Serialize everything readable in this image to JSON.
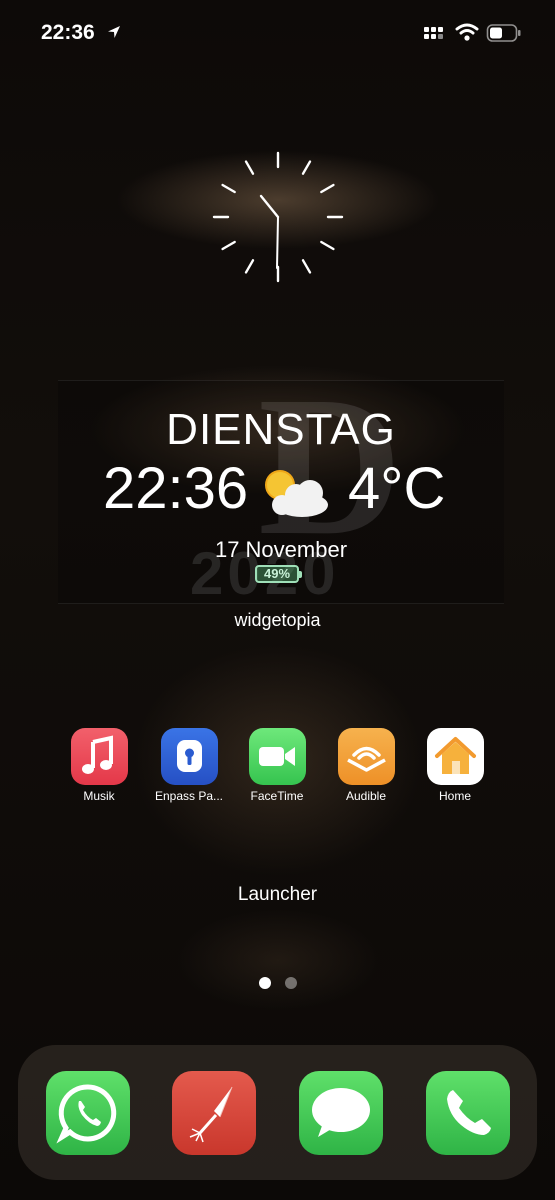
{
  "status_bar": {
    "time": "22:36"
  },
  "widget": {
    "day": "DIENSTAG",
    "time": "22:36",
    "temperature": "4°C",
    "date": "17 November",
    "battery": "49%",
    "bg_letter": "D",
    "bg_year": "2020",
    "label": "widgetopia"
  },
  "apps": [
    {
      "label": "Musik",
      "icon": "music-icon"
    },
    {
      "label": "Enpass Pa...",
      "icon": "enpass-keyhole-icon"
    },
    {
      "label": "FaceTime",
      "icon": "facetime-camera-icon"
    },
    {
      "label": "Audible",
      "icon": "audible-icon"
    },
    {
      "label": "Home",
      "icon": "home-icon"
    }
  ],
  "folder_label": "Launcher",
  "page_indicator": {
    "pages": 2,
    "current": 1
  },
  "dock": [
    {
      "icon": "whatsapp-icon"
    },
    {
      "icon": "rocket-icon"
    },
    {
      "icon": "messages-icon"
    },
    {
      "icon": "phone-icon"
    }
  ],
  "colors": {
    "music": "#e8424f",
    "enpass": "#2f64d8",
    "facetime": "#4cd964",
    "audible": "#f3a23a",
    "home": "#ffffff",
    "whatsapp": "#3fc34f",
    "rocket": "#d9463b",
    "messages": "#3fc34f",
    "phone": "#3fc34f"
  }
}
